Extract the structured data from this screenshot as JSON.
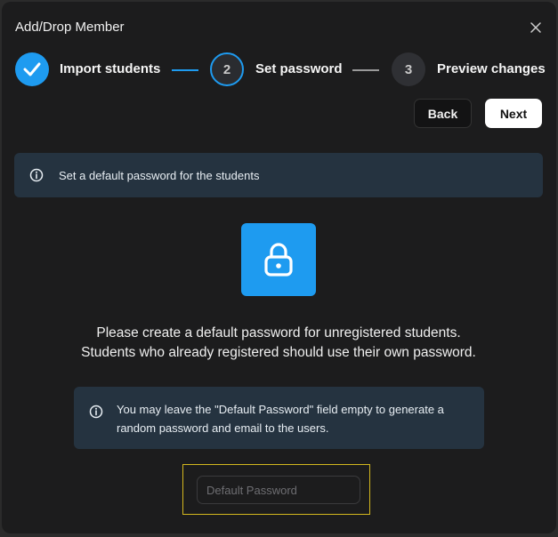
{
  "dialog": {
    "title": "Add/Drop Member"
  },
  "stepper": {
    "steps": [
      {
        "number": "",
        "label": "Import students",
        "state": "completed"
      },
      {
        "number": "2",
        "label": "Set password",
        "state": "active"
      },
      {
        "number": "3",
        "label": "Preview changes",
        "state": "upcoming"
      }
    ]
  },
  "actions": {
    "back_label": "Back",
    "next_label": "Next"
  },
  "info_banner": {
    "text": "Set a default password for the students",
    "icon": "info-icon"
  },
  "main": {
    "icon": "lock-icon",
    "line1": "Please create a default password for unregistered students.",
    "line2": "Students who already registered should use their own password."
  },
  "note": {
    "icon": "info-icon",
    "text": "You may leave the \"Default Password\" field empty to generate a random password and email to the users."
  },
  "password_field": {
    "placeholder": "Default Password",
    "value": ""
  },
  "colors": {
    "accent": "#1e9bf0",
    "banner": "#253340",
    "background": "#1c1c1d",
    "focus_outline": "#d4b81e"
  }
}
